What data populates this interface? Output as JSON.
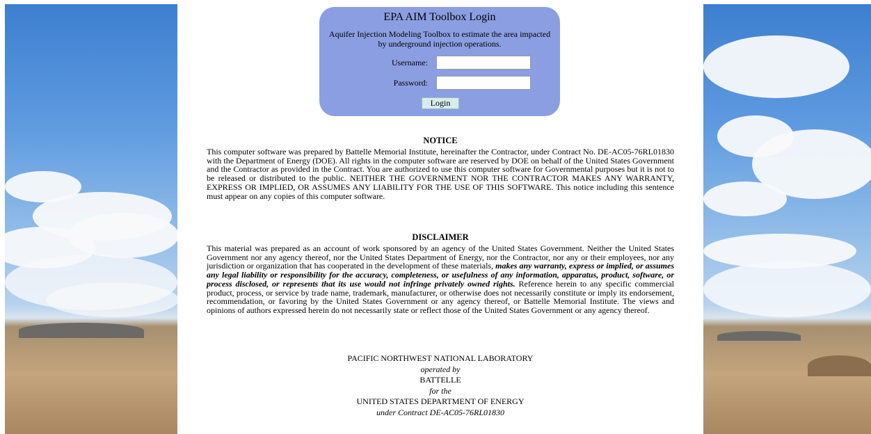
{
  "login": {
    "title": "EPA AIM Toolbox Login",
    "subtitle": "Aquifer Injection Modeling Toolbox to estimate the area impacted by underground injection operations.",
    "username_label": "Username:",
    "password_label": "Password:",
    "username_value": "",
    "password_value": "",
    "button_label": "Login"
  },
  "notice": {
    "heading": "NOTICE",
    "text": "This computer software was prepared by Battelle Memorial Institute, hereinafter the Contractor, under Contract No. DE-AC05-76RL01830 with the Department of Energy (DOE).  All rights in the computer software are reserved by DOE on behalf of the United States Government and the Contractor as provided in the Contract.  You are authorized to use this computer software for Governmental purposes but it is not to be released or distributed to the public.  NEITHER THE GOVERNMENT NOR THE CONTRACTOR MAKES ANY WARRANTY, EXPRESS OR IMPLIED, OR ASSUMES ANY LIABILITY FOR THE USE OF THIS SOFTWARE.  This notice including this sentence must appear on any copies of this computer software."
  },
  "disclaimer": {
    "heading": "DISCLAIMER",
    "text_start": "This material was prepared as an account of work sponsored by an agency of the United States Government.  Neither the United States Government nor any agency thereof, nor the United States Department of Energy, nor the Contractor, nor any or their employees, nor any jurisdiction or organization that has cooperated in the development of these materials, ",
    "text_emphasis": "makes any warranty, express or implied, or assumes any legal liability or responsibility for the accuracy, completeness, or usefulness of any information, apparatus, product, software, or process disclosed, or represents that its use would not infringe privately owned rights.",
    "text_end": "  Reference herein to any specific commercial product, process, or service by trade name, trademark, manufacturer, or otherwise does not necessarily constitute or imply its endorsement, recommendation, or favoring by the United States Government or any agency thereof, or Battelle Memorial Institute.  The views and opinions of authors expressed herein do not necessarily state or reflect those of the United States Government or any agency thereof."
  },
  "footer": {
    "line1": "PACIFIC NORTHWEST NATIONAL LABORATORY",
    "line2": "operated by",
    "line3": "BATTELLE",
    "line4": "for the",
    "line5": "UNITED STATES DEPARTMENT OF ENERGY",
    "line6": "under Contract DE-AC05-76RL01830"
  },
  "colors": {
    "login_box": "#8c9ee2",
    "button": "#d7ecec",
    "page_background": "#ffffff"
  }
}
